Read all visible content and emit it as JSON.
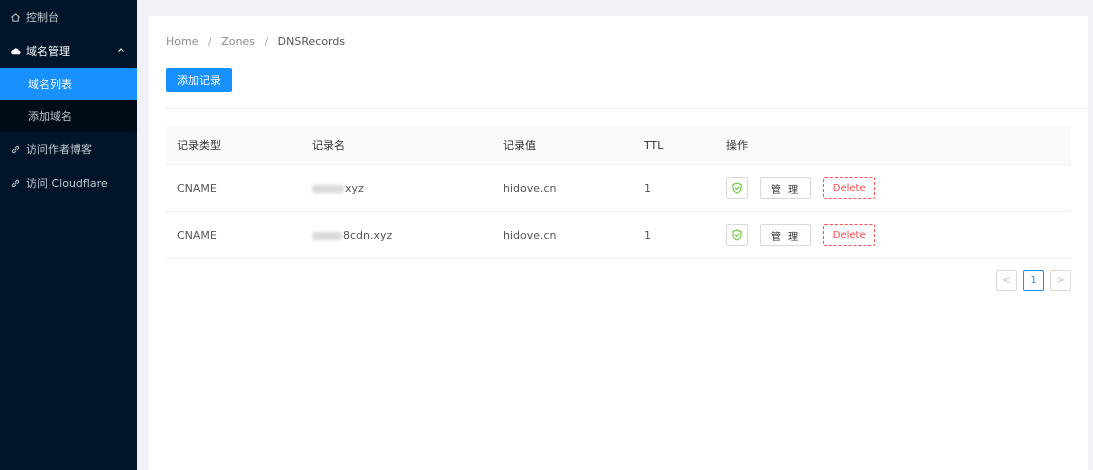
{
  "sidebar": {
    "items": [
      {
        "label": "控制台",
        "icon": "home-icon"
      },
      {
        "label": "域名管理",
        "icon": "cloud-icon",
        "expanded": true,
        "children": [
          {
            "label": "域名列表",
            "active": true
          },
          {
            "label": "添加域名",
            "active": false
          }
        ]
      },
      {
        "label": "访问作者博客",
        "icon": "link-icon"
      },
      {
        "label": "访问 Cloudflare",
        "icon": "link-icon"
      }
    ]
  },
  "breadcrumb": {
    "home": "Home",
    "zones": "Zones",
    "current": "DNSRecords",
    "separator": "/"
  },
  "toolbar": {
    "add_record_label": "添加记录"
  },
  "table": {
    "headers": [
      "记录类型",
      "记录名",
      "记录值",
      "TTL",
      "操作"
    ],
    "rows": [
      {
        "type": "CNAME",
        "name": "xyz",
        "value": "hidove.cn",
        "ttl": "1"
      },
      {
        "type": "CNAME",
        "name": "8cdn.xyz",
        "value": "hidove.cn",
        "ttl": "1"
      }
    ],
    "actions": {
      "manage_label": "管 理",
      "delete_label": "Delete"
    }
  },
  "pagination": {
    "prev": "<",
    "current_page": "1",
    "next": ">"
  },
  "colors": {
    "primary": "#1890ff",
    "sidebar_bg": "#001529",
    "danger": "#ff4d4f",
    "success": "#52c41a"
  }
}
